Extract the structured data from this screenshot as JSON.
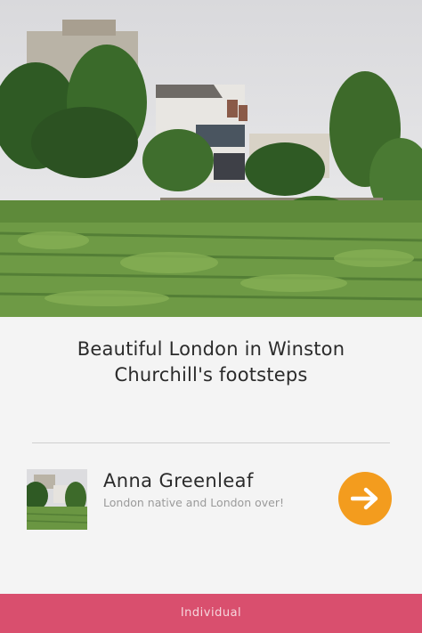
{
  "card": {
    "title": "Beautiful London in Winston Churchill's footsteps"
  },
  "author": {
    "name": "Anna Greenleaf",
    "bio": "London native and London over!"
  },
  "action": {
    "icon": "arrow-right-icon",
    "color": "#f39c1e"
  },
  "footer": {
    "label": "Individual",
    "color": "#d94f6e"
  }
}
